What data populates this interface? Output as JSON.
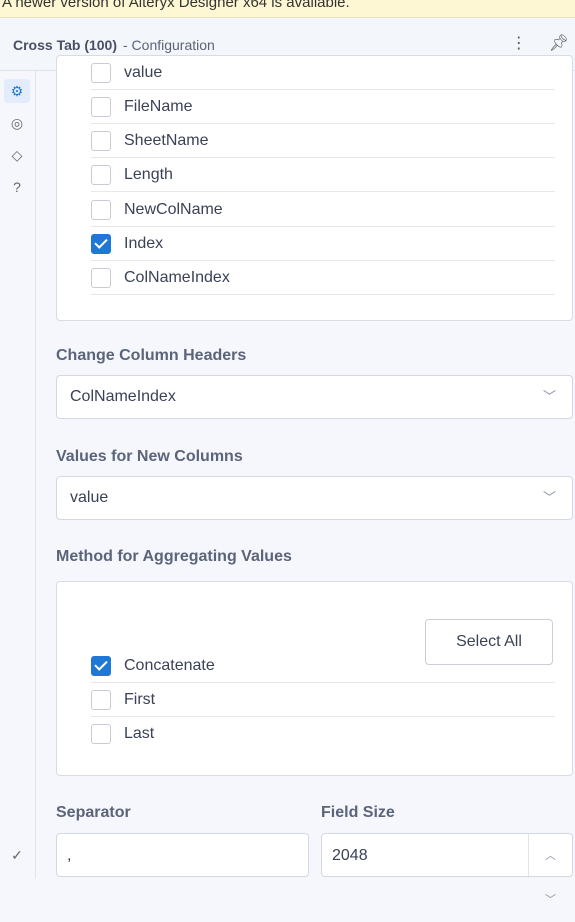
{
  "banner": {
    "text": "A newer version of Alteryx Designer x64 is available."
  },
  "header": {
    "title": "Cross Tab (100)",
    "subtitle": "- Configuration",
    "more_icon": "⋮",
    "pin_icon": "pin"
  },
  "rail": {
    "icons": [
      "gear-icon",
      "connection-icon",
      "tag-icon",
      "help-icon",
      "check-circle-icon"
    ]
  },
  "group_by": {
    "fields": [
      {
        "label": "value",
        "checked": false
      },
      {
        "label": "FileName",
        "checked": false
      },
      {
        "label": "SheetName",
        "checked": false
      },
      {
        "label": "Length",
        "checked": false
      },
      {
        "label": "NewColName",
        "checked": false
      },
      {
        "label": "Index",
        "checked": true
      },
      {
        "label": "ColNameIndex",
        "checked": false
      }
    ]
  },
  "headers": {
    "label": "Change Column Headers",
    "value": "ColNameIndex"
  },
  "values": {
    "label": "Values for New Columns",
    "value": "value"
  },
  "aggregation": {
    "label": "Method for Aggregating Values",
    "select_all": "Select All",
    "methods": [
      {
        "label": "Concatenate",
        "checked": true
      },
      {
        "label": "First",
        "checked": false
      },
      {
        "label": "Last",
        "checked": false
      }
    ]
  },
  "separator": {
    "label": "Separator",
    "value": ","
  },
  "field_size": {
    "label": "Field Size",
    "value": "2048"
  }
}
